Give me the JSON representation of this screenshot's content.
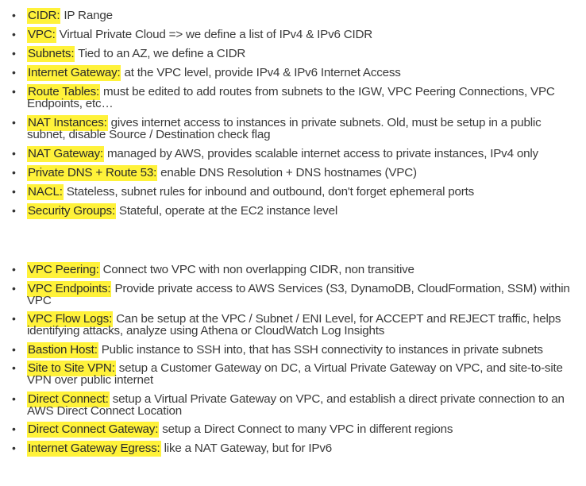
{
  "colors": {
    "highlight": "#fff23a",
    "text": "#333333"
  },
  "icons": {
    "bullet": "bullet-dot"
  },
  "group1": [
    {
      "term": "CIDR:",
      "desc": " IP Range"
    },
    {
      "term": "VPC:",
      "desc": " Virtual Private Cloud => we define a list of IPv4 & IPv6 CIDR"
    },
    {
      "term": "Subnets:",
      "desc": " Tied to an AZ, we define a CIDR"
    },
    {
      "term": "Internet Gateway:",
      "desc": " at the VPC level, provide IPv4 & IPv6 Internet Access"
    },
    {
      "term": "Route Tables:",
      "desc": " must be edited to add routes from subnets to the IGW, VPC Peering Connections, VPC Endpoints, etc…"
    },
    {
      "term": "NAT Instances:",
      "desc": " gives internet access to instances in private subnets. Old, must be setup in a public subnet, disable Source / Destination check flag"
    },
    {
      "term": "NAT Gateway:",
      "desc": " managed by AWS, provides scalable internet access to private instances, IPv4 only"
    },
    {
      "term": "Private DNS + Route 53:",
      "desc": " enable DNS Resolution + DNS hostnames (VPC)"
    },
    {
      "term": "NACL:",
      "desc": " Stateless, subnet rules for inbound and outbound, don't forget ephemeral ports"
    },
    {
      "term": "Security Groups:",
      "desc": " Stateful, operate at the EC2 instance level"
    }
  ],
  "group2": [
    {
      "term": "VPC Peering:",
      "desc": " Connect two VPC with non overlapping CIDR, non transitive"
    },
    {
      "term": "VPC Endpoints:",
      "desc": " Provide private access to AWS Services (S3, DynamoDB, CloudFormation, SSM) within VPC"
    },
    {
      "term": "VPC Flow Logs:",
      "desc": " Can be setup at the VPC / Subnet / ENI Level, for ACCEPT and REJECT traffic, helps identifying attacks, analyze using Athena or CloudWatch Log Insights"
    },
    {
      "term": "Bastion Host:",
      "desc": " Public instance to SSH into, that has SSH connectivity to instances in private subnets"
    },
    {
      "term": "Site to Site VPN:",
      "desc": " setup a Customer Gateway on DC, a Virtual Private Gateway on VPC, and site-to-site VPN over public internet"
    },
    {
      "term": "Direct Connect:",
      "desc": " setup a Virtual Private Gateway on VPC, and establish a direct private connection to an AWS Direct Connect Location"
    },
    {
      "term": "Direct Connect Gateway:",
      "desc": " setup a Direct Connect to many VPC in different regions"
    },
    {
      "term": "Internet Gateway Egress:",
      "desc": " like a NAT Gateway, but for IPv6"
    }
  ]
}
